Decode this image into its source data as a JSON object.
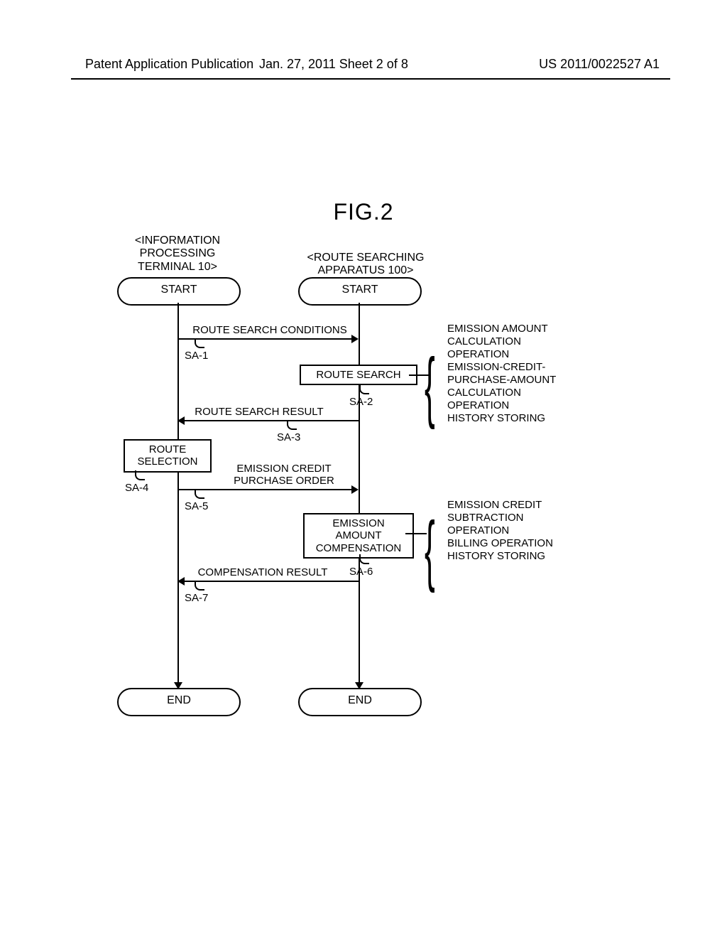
{
  "header": {
    "left": "Patent Application Publication",
    "mid": "Jan. 27, 2011  Sheet 2 of 8",
    "right": "US 2011/0022527 A1"
  },
  "fig_title": "FIG.2",
  "columns": {
    "left_title": "<INFORMATION\nPROCESSING\nTERMINAL 10>",
    "right_title": "<ROUTE SEARCHING\nAPPARATUS 100>"
  },
  "terminals": {
    "start": "START",
    "end": "END"
  },
  "boxes": {
    "route_search": "ROUTE SEARCH",
    "route_selection": "ROUTE\nSELECTION",
    "emission_comp": "EMISSION\nAMOUNT\nCOMPENSATION"
  },
  "messages": {
    "sa1": "ROUTE SEARCH CONDITIONS",
    "sa3": "ROUTE SEARCH RESULT",
    "sa5": "EMISSION CREDIT\nPURCHASE ORDER",
    "sa7": "COMPENSATION RESULT"
  },
  "step_ids": {
    "sa1": "SA-1",
    "sa2": "SA-2",
    "sa3": "SA-3",
    "sa4": "SA-4",
    "sa5": "SA-5",
    "sa6": "SA-6",
    "sa7": "SA-7"
  },
  "side_notes": {
    "upper": "EMISSION AMOUNT\nCALCULATION\nOPERATION\nEMISSION-CREDIT-\nPURCHASE-AMOUNT\nCALCULATION\nOPERATION\nHISTORY STORING",
    "lower": "EMISSION CREDIT\nSUBTRACTION\nOPERATION\nBILLING OPERATION\nHISTORY STORING"
  }
}
